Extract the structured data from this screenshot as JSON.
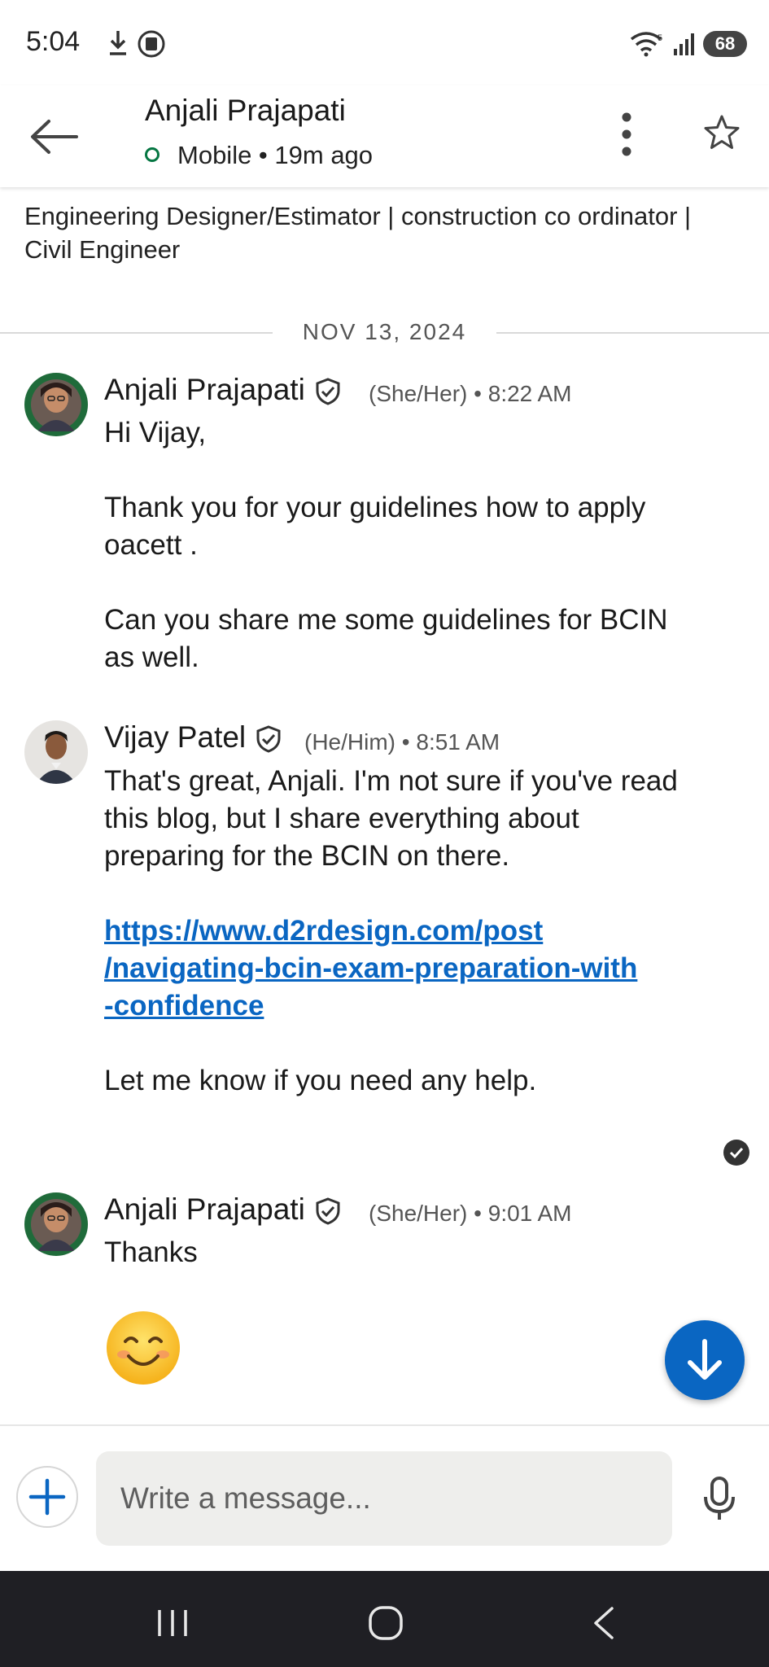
{
  "status_bar": {
    "time": "5:04",
    "battery": "68",
    "icons": [
      "download-icon",
      "badge-icon",
      "wifi-icon",
      "signal-icon"
    ]
  },
  "header": {
    "name": "Anjali Prajapati",
    "presence": "Mobile • 19m ago",
    "presence_color": "#057642"
  },
  "profile": {
    "headline": "Engineering Designer/Estimator | construction co ordinator | Civil Engineer"
  },
  "date_divider": "NOV 13, 2024",
  "messages": [
    {
      "sender": "Anjali Prajapati",
      "pronouns": "(She/Her)",
      "time": "8:22 AM",
      "lines": [
        "Hi Vijay,",
        "Thank you for your guidelines how to apply oacett .",
        "Can you share me some guidelines for BCIN as well."
      ]
    },
    {
      "sender": "Vijay Patel",
      "pronouns": "(He/Him)",
      "time": "8:51 AM",
      "lines": [
        "That's great, Anjali. I'm not sure if you've read this blog, but I share everything about preparing for the BCIN on there.",
        "Let me know if you need any help."
      ],
      "link": "https://www.d2rdesign.com/post/navigating-bcin-exam-preparation-with-confidence",
      "link_display": [
        "https://www.d2rdesign.com/post",
        "/navigating-bcin-exam-preparation-with",
        "-confidence"
      ]
    },
    {
      "sender": "Anjali Prajapati",
      "pronouns": "(She/Her)",
      "time": "9:01 AM",
      "lines": [
        "Thanks"
      ],
      "emoji": "😊"
    }
  ],
  "composer": {
    "placeholder": "Write a message..."
  },
  "colors": {
    "accent": "#0a66c2",
    "nav_bar": "#1f1f24"
  }
}
